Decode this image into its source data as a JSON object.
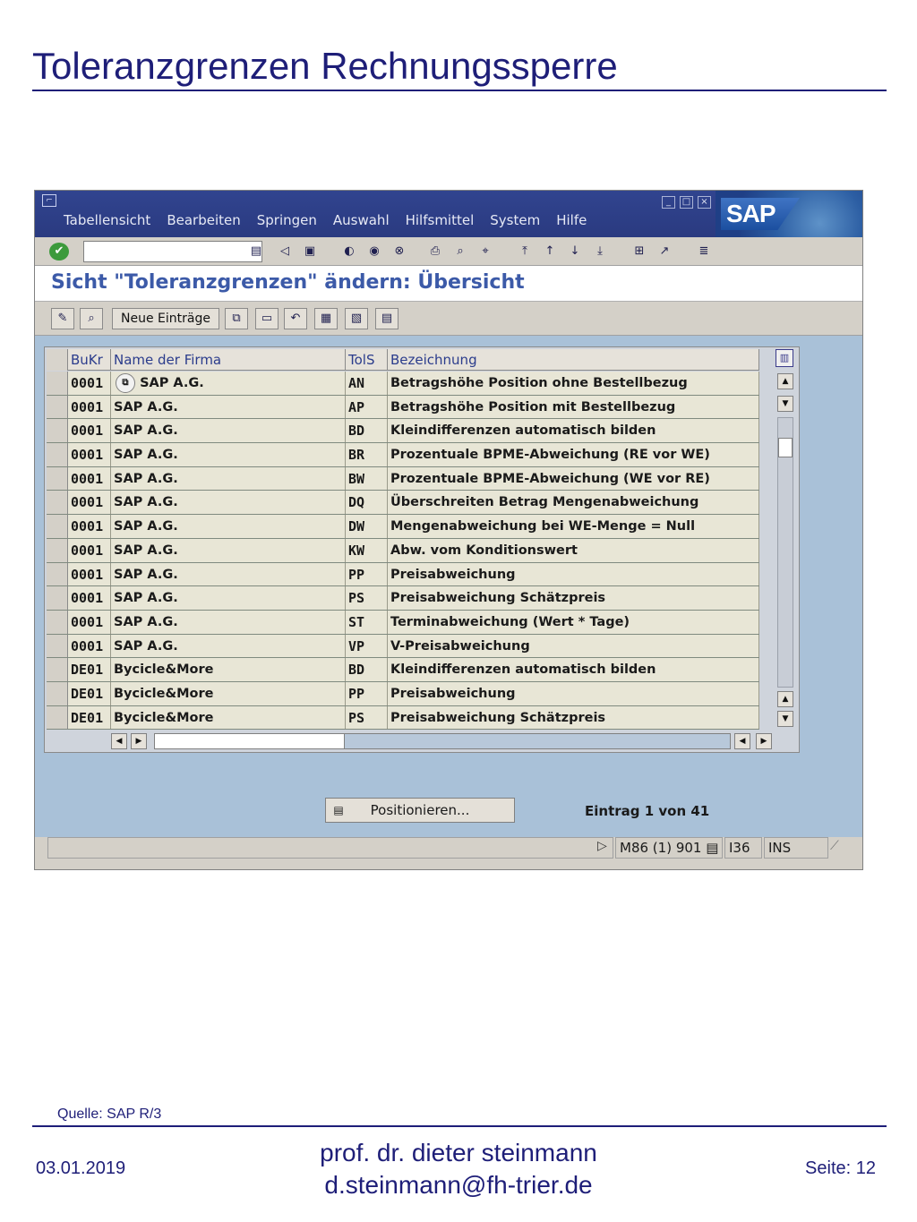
{
  "slide": {
    "title": "Toleranzgrenzen Rechnungssperre",
    "source": "Quelle: SAP R/3",
    "date": "03.01.2019",
    "author_line1": "prof. dr. dieter steinmann",
    "author_line2": "d.steinmann@fh-trier.de",
    "page": "Seite: 12"
  },
  "sap": {
    "menu": [
      "Tabellensicht",
      "Bearbeiten",
      "Springen",
      "Auswahl",
      "Hilfsmittel",
      "System",
      "Hilfe"
    ],
    "window_controls": [
      "_",
      "□",
      "×"
    ],
    "logo": "SAP",
    "command_field_value": "",
    "screen_title": "Sicht \"Toleranzgrenzen\" ändern: Übersicht",
    "app_toolbar": {
      "new_entries_label": "Neue Einträge"
    },
    "table": {
      "columns": [
        "BuKr",
        "Name der Firma",
        "TolS",
        "Bezeichnung"
      ],
      "rows": [
        [
          "0001",
          "SAP A.G.",
          "AN",
          "Betragshöhe Position ohne Bestellbezug"
        ],
        [
          "0001",
          "SAP A.G.",
          "AP",
          "Betragshöhe Position mit Bestellbezug"
        ],
        [
          "0001",
          "SAP A.G.",
          "BD",
          "Kleindifferenzen automatisch bilden"
        ],
        [
          "0001",
          "SAP A.G.",
          "BR",
          "Prozentuale BPME-Abweichung (RE vor WE)"
        ],
        [
          "0001",
          "SAP A.G.",
          "BW",
          "Prozentuale BPME-Abweichung (WE vor RE)"
        ],
        [
          "0001",
          "SAP A.G.",
          "DQ",
          "Überschreiten Betrag Mengenabweichung"
        ],
        [
          "0001",
          "SAP A.G.",
          "DW",
          "Mengenabweichung bei WE-Menge = Null"
        ],
        [
          "0001",
          "SAP A.G.",
          "KW",
          "Abw. vom Konditionswert"
        ],
        [
          "0001",
          "SAP A.G.",
          "PP",
          "Preisabweichung"
        ],
        [
          "0001",
          "SAP A.G.",
          "PS",
          "Preisabweichung Schätzpreis"
        ],
        [
          "0001",
          "SAP A.G.",
          "ST",
          "Terminabweichung (Wert * Tage)"
        ],
        [
          "0001",
          "SAP A.G.",
          "VP",
          "V-Preisabweichung"
        ],
        [
          "DE01",
          "Bycicle&More",
          "BD",
          "Kleindifferenzen automatisch bilden"
        ],
        [
          "DE01",
          "Bycicle&More",
          "PP",
          "Preisabweichung"
        ],
        [
          "DE01",
          "Bycicle&More",
          "PS",
          "Preisabweichung Schätzpreis"
        ]
      ]
    },
    "position_button_label": "Positionieren...",
    "entry_info": "Eintrag 1 von 41",
    "status": {
      "system": "M86 (1) 901",
      "server": "I36",
      "mode": "INS"
    }
  }
}
